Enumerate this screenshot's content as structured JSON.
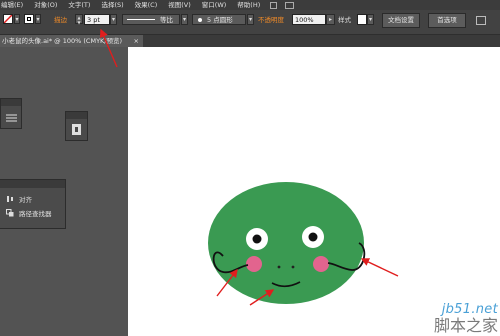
{
  "menu": [
    "编辑(E)",
    "对象(O)",
    "文字(T)",
    "选择(S)",
    "效果(C)",
    "视图(V)",
    "窗口(W)",
    "帮助(H)"
  ],
  "control": {
    "stroke_label": "描边",
    "stroke_value": "3 pt",
    "profile_label": "等比",
    "brush_label": "5 点圆形",
    "opacity_label": "不透明度",
    "opacity_value": "100%",
    "style_label": "样式",
    "doc_setup_button": "文档设置",
    "preferences_button": "首选项"
  },
  "document_tab": {
    "title": "小老鼠的头像.ai* @ 100% (CMYK/预览)",
    "close": "×"
  },
  "align_panel": {
    "items": [
      "对齐",
      "路径查找器"
    ]
  },
  "watermark": {
    "site": "jb51.net",
    "name": "脚本之家"
  },
  "colors": {
    "face": "#3a9a52",
    "cheek": "#e2648e",
    "arrow": "#e01e1e",
    "accent_text": "#f28c28"
  }
}
